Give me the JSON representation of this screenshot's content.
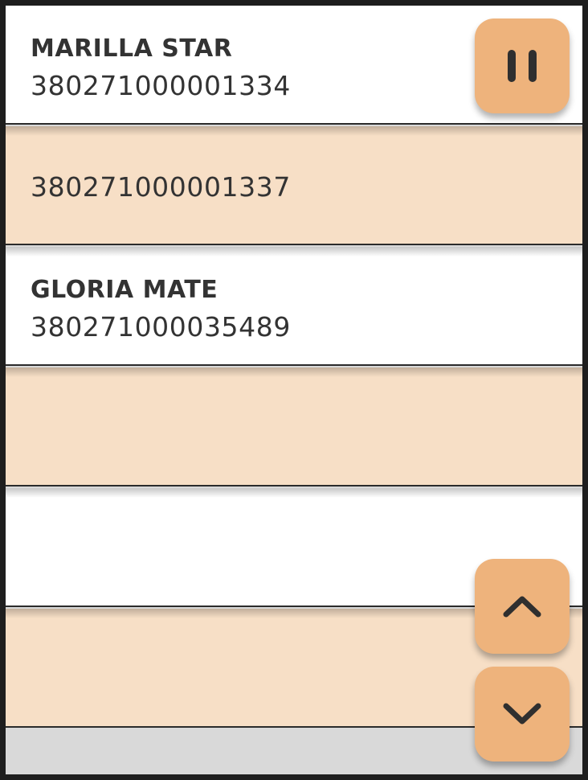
{
  "list": {
    "rows": [
      {
        "name": "MARILLA STAR",
        "number": "380271000001334"
      },
      {
        "name": "",
        "number": "380271000001337"
      },
      {
        "name": "GLORIA MATE",
        "number": "380271000035489"
      },
      {
        "name": "",
        "number": ""
      },
      {
        "name": "",
        "number": ""
      },
      {
        "name": "",
        "number": ""
      }
    ]
  },
  "controls": {
    "pause_icon": "pause-icon",
    "up_icon": "chevron-up-icon",
    "down_icon": "chevron-down-icon"
  },
  "colors": {
    "accent": "#eeb37c",
    "row_alt": "#f7dfc6",
    "row": "#ffffff",
    "text": "#333333"
  }
}
